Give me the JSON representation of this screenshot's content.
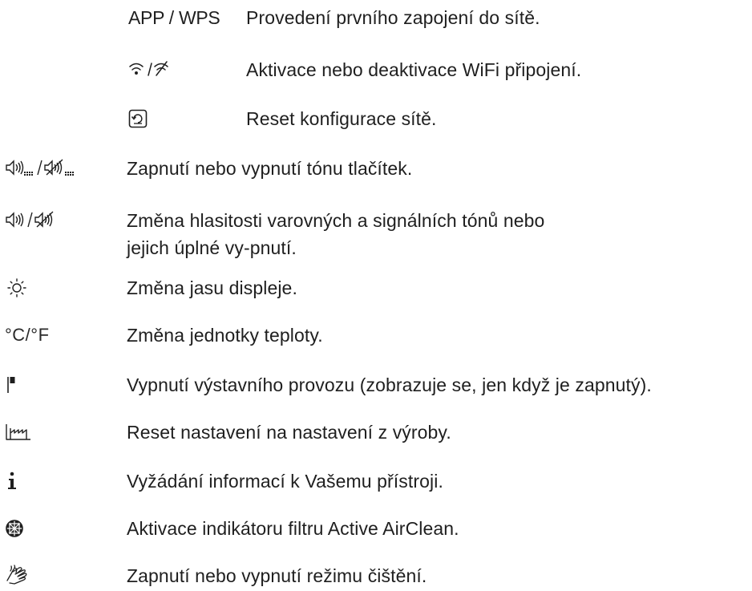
{
  "network_settings": [
    {
      "icon": "app-wps",
      "symbol": "APP / WPS",
      "text": "Provedení prvního zapojení do sítě."
    },
    {
      "icon": "wifi-on-off-icon",
      "text": "Aktivace nebo deaktivace WiFi připojení."
    },
    {
      "icon": "network-reset-icon",
      "text": "Reset konfigurace sítě."
    }
  ],
  "settings": [
    {
      "icon": "keypad-tone-on-off-icon",
      "text": "Zapnutí nebo vypnutí tónu tlačítek."
    },
    {
      "icon": "volume-on-off-icon",
      "text": "Změna hlasitosti varovných a signálních tónů nebo jejich úplné vy-pnutí."
    },
    {
      "icon": "brightness-icon",
      "text": "Změna jasu displeje."
    },
    {
      "icon": "temperature-unit",
      "symbol": "°C/°F",
      "text": "Změna jednotky teploty."
    },
    {
      "icon": "demo-mode-icon",
      "text": "Vypnutí výstavního provozu (zobrazuje se, jen když je zapnutý)."
    },
    {
      "icon": "factory-reset-icon",
      "text": "Reset nastavení na nastavení z výroby."
    },
    {
      "icon": "info-icon",
      "text": "Vyžádání informací k Vašemu přístroji."
    },
    {
      "icon": "active-airclean-filter-icon",
      "text": "Aktivace indikátoru filtru Active AirClean."
    },
    {
      "icon": "cleaning-mode-icon",
      "text": "Zapnutí nebo vypnutí režimu čištění."
    }
  ]
}
